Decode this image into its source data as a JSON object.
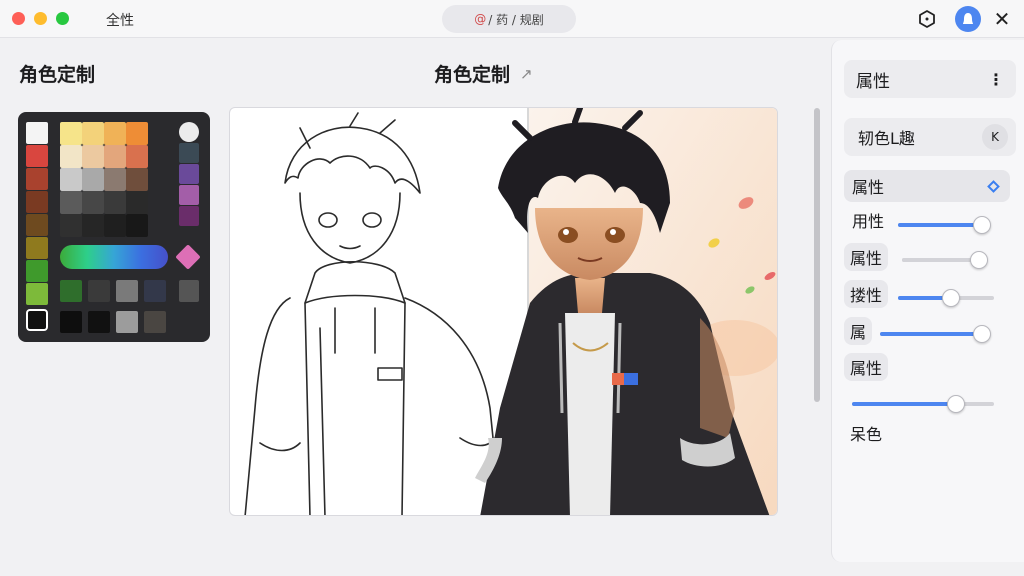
{
  "window": {
    "app_title": "全性",
    "address_lead": "@",
    "address_text": "/ 药 / 规剧"
  },
  "left": {
    "heading": "角色定制"
  },
  "center": {
    "heading": "角色定制",
    "heading_arrow": "↗"
  },
  "palette": {
    "column_left": [
      "#f4f4f4",
      "#d9463f",
      "#a9422e",
      "#7a3a22",
      "#6e4a1f",
      "#8f7a1e",
      "#3f9a2c",
      "#7dba3a",
      "#111111"
    ],
    "grid_rows": [
      [
        "#f6e48a",
        "#f3d27a",
        "#f0b257",
        "#ee8d36"
      ],
      [
        "#f2e5c7",
        "#ecc9a0",
        "#e3a67c",
        "#d9714e"
      ],
      [
        "#c9c9c9",
        "#a9a9a9",
        "#8b7a70",
        "#6f4e3c"
      ],
      [
        "#5b5b5b",
        "#474747",
        "#3a3a3a",
        "#2a2a2a"
      ],
      [
        "#303030",
        "#262626",
        "#1f1f1f",
        "#181818"
      ]
    ],
    "gradient_bar": [
      "#3cab3a",
      "#2ecf8a",
      "#36a5d6",
      "#3b6fe0",
      "#4650c9"
    ],
    "texture_row": [
      "#2f6e2c",
      "#3a3a3a",
      "#7a7a7a",
      "#33384a"
    ],
    "bottom_row": [
      "#0e0e0e",
      "#111111",
      "#9c9c9c",
      "#4a4642"
    ],
    "column_right": [
      "#ececec",
      "#3b4a55",
      "#6a4a9a",
      "#a35ea8",
      "#6a2d6a"
    ],
    "accent_diamond": "#dd6fb6",
    "right_extra": "#555555"
  },
  "right_panel": {
    "header_label": "属性",
    "header_more": "⋮",
    "preset_label": "轫色L趣",
    "preset_button": "K",
    "selected_label": "属性",
    "properties": [
      {
        "label": "用性",
        "value": 0.93
      },
      {
        "label": "属性",
        "value": 0.89
      },
      {
        "label": "搂性",
        "value": 0.55
      },
      {
        "label": "属",
        "value": 0.94
      },
      {
        "label": "属性",
        "value": null
      },
      {
        "label": "",
        "value": 0.73
      }
    ],
    "footer_label": "呆色"
  },
  "colors": {
    "accent": "#4d86f0",
    "window_bg": "#f1f1f3"
  }
}
